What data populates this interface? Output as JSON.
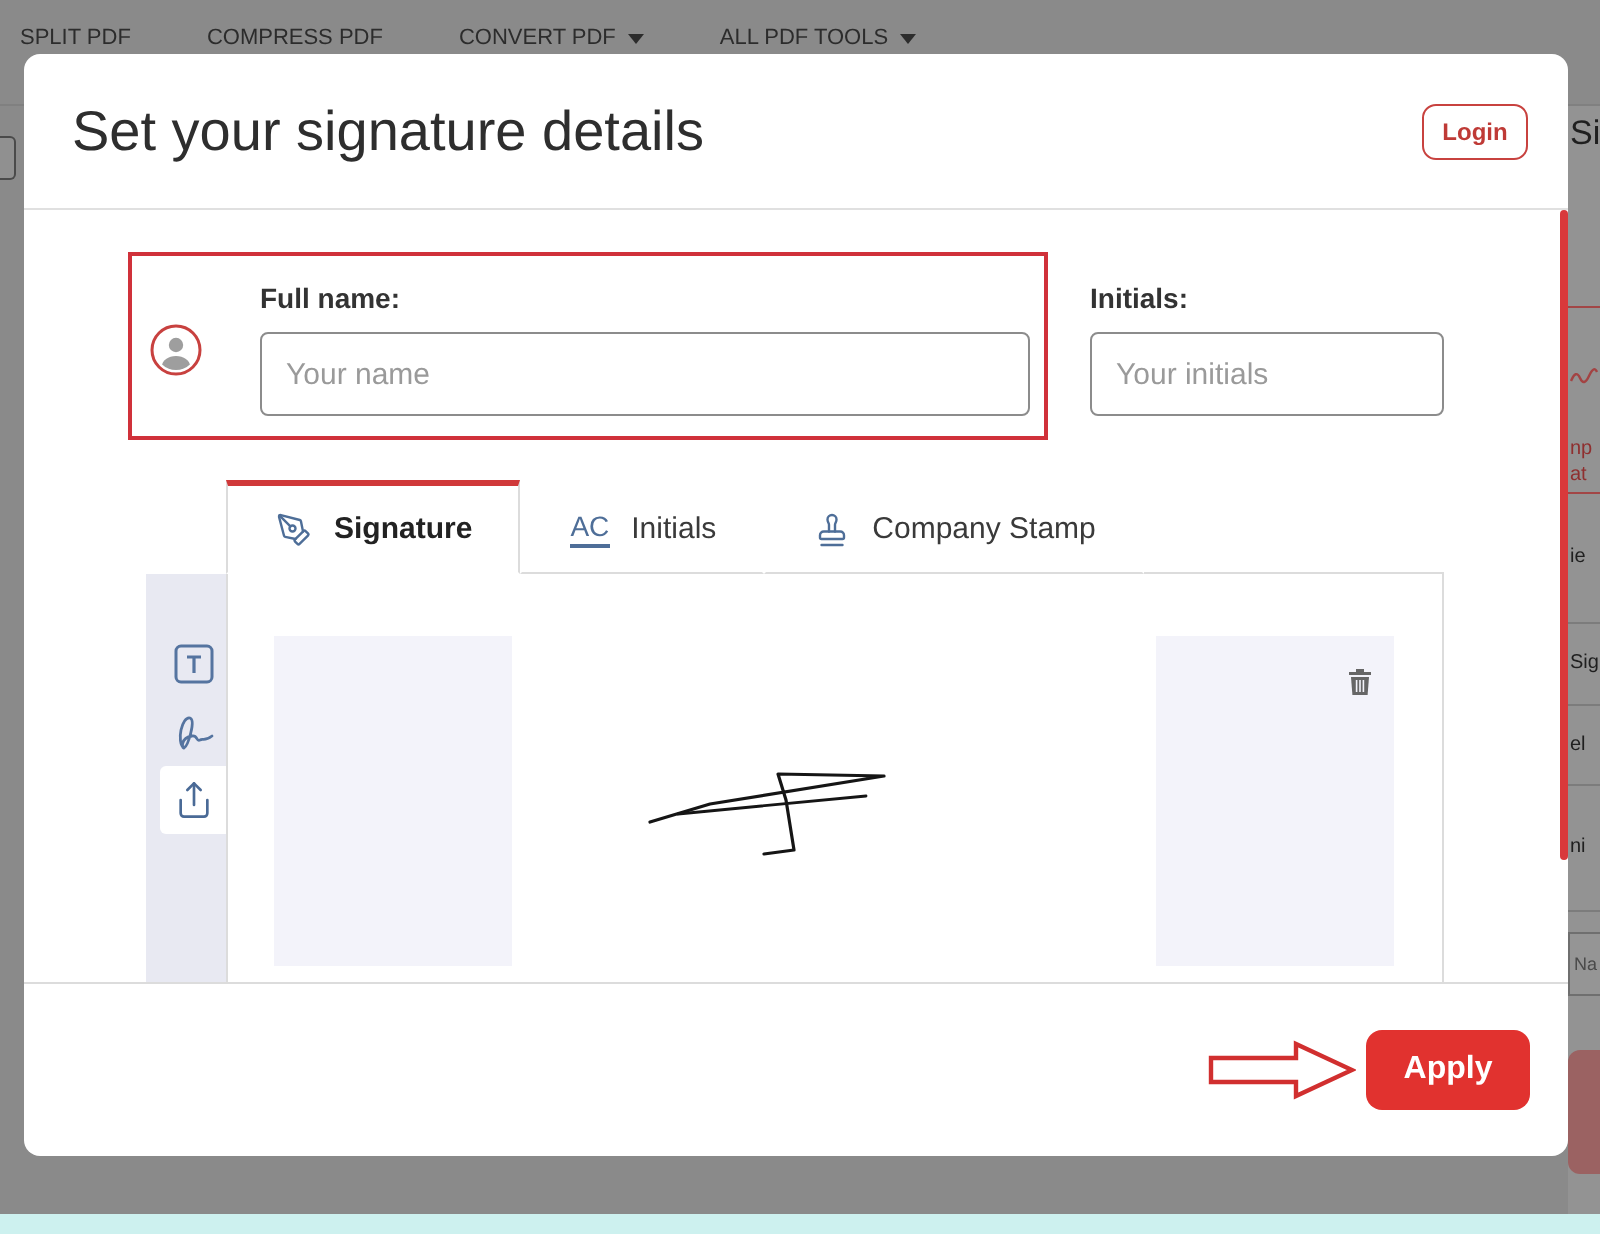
{
  "background_page": {
    "nav": [
      {
        "label": "SPLIT PDF",
        "dropdown": false
      },
      {
        "label": "COMPRESS PDF",
        "dropdown": false
      },
      {
        "label": "CONVERT PDF",
        "dropdown": true
      },
      {
        "label": "ALL PDF TOOLS",
        "dropdown": true
      }
    ],
    "side_panel": {
      "heading": "Si",
      "note_lines": [
        "np",
        "at"
      ],
      "rows": [
        "ie",
        "Sig",
        "el",
        "ni"
      ],
      "field_placeholder": "Na"
    }
  },
  "dialog": {
    "title": "Set your signature details",
    "login_button": "Login",
    "full_name": {
      "label": "Full name:",
      "placeholder": "Your name",
      "highlighted": true
    },
    "initials": {
      "label": "Initials:",
      "placeholder": "Your initials"
    },
    "tabs": [
      {
        "label": "Signature",
        "kind": "signature",
        "selected": true
      },
      {
        "label": "Initials",
        "kind": "initials",
        "icon_text": "AC",
        "selected": false
      },
      {
        "label": "Company Stamp",
        "kind": "stamp",
        "selected": false
      }
    ],
    "tools": [
      {
        "kind": "text",
        "selected": false
      },
      {
        "kind": "draw",
        "selected": false
      },
      {
        "kind": "upload",
        "selected": true
      }
    ],
    "apply_button": "Apply",
    "apply_arrow": true
  }
}
